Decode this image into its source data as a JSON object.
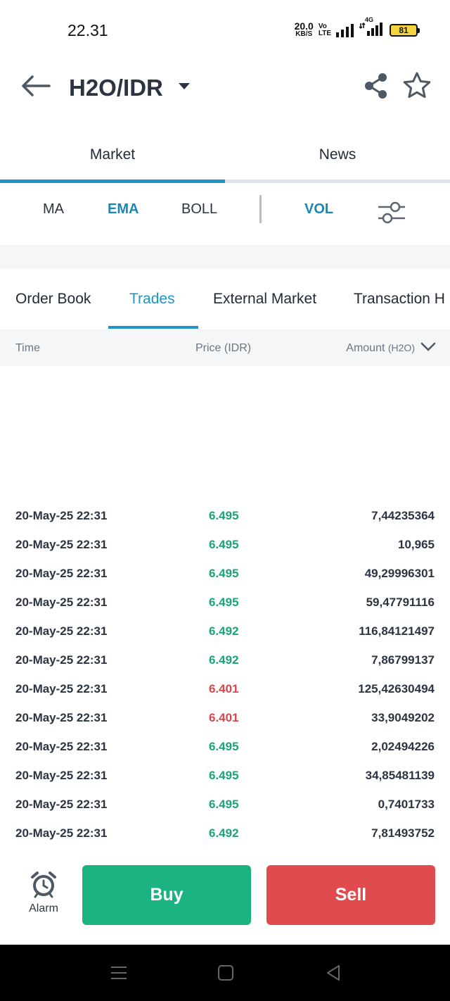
{
  "status_bar": {
    "time": "22.31",
    "net_speed_value": "20.0",
    "net_speed_unit": "KB/S",
    "volte_top": "Vo",
    "volte_bottom": "LTE",
    "network": "4G",
    "battery": "81"
  },
  "header": {
    "pair": "H2O/IDR",
    "icons": [
      "back-arrow-icon",
      "caret-down-icon",
      "share-icon",
      "star-icon"
    ]
  },
  "main_tabs": [
    {
      "label": "Market",
      "active": true
    },
    {
      "label": "News",
      "active": false
    }
  ],
  "indicators": {
    "items": [
      {
        "label": "MA",
        "active": false
      },
      {
        "label": "EMA",
        "active": true
      },
      {
        "label": "BOLL",
        "active": false
      },
      {
        "label": "VOL",
        "active": true
      }
    ],
    "settings_icon": "sliders-icon"
  },
  "sub_tabs": [
    {
      "label": "Order Book",
      "active": false
    },
    {
      "label": "Trades",
      "active": true
    },
    {
      "label": "External Market",
      "active": false
    },
    {
      "label": "Transaction H",
      "active": false
    }
  ],
  "table": {
    "headers": {
      "time": "Time",
      "price": "Price (IDR)",
      "amount": "Amount",
      "amount_unit": "(H2O)"
    },
    "rows": [
      {
        "time": "20-May-25 22:31",
        "price": "6.495",
        "side": "up",
        "amount": "7,44235364"
      },
      {
        "time": "20-May-25 22:31",
        "price": "6.495",
        "side": "up",
        "amount": "10,965"
      },
      {
        "time": "20-May-25 22:31",
        "price": "6.495",
        "side": "up",
        "amount": "49,29996301"
      },
      {
        "time": "20-May-25 22:31",
        "price": "6.495",
        "side": "up",
        "amount": "59,47791116"
      },
      {
        "time": "20-May-25 22:31",
        "price": "6.492",
        "side": "up",
        "amount": "116,84121497"
      },
      {
        "time": "20-May-25 22:31",
        "price": "6.492",
        "side": "up",
        "amount": "7,86799137"
      },
      {
        "time": "20-May-25 22:31",
        "price": "6.401",
        "side": "down",
        "amount": "125,42630494"
      },
      {
        "time": "20-May-25 22:31",
        "price": "6.401",
        "side": "down",
        "amount": "33,9049202"
      },
      {
        "time": "20-May-25 22:31",
        "price": "6.495",
        "side": "up",
        "amount": "2,02494226"
      },
      {
        "time": "20-May-25 22:31",
        "price": "6.495",
        "side": "up",
        "amount": "34,85481139"
      },
      {
        "time": "20-May-25 22:31",
        "price": "6.495",
        "side": "up",
        "amount": "0,7401733"
      },
      {
        "time": "20-May-25 22:31",
        "price": "6.492",
        "side": "up",
        "amount": "7,81493752"
      }
    ]
  },
  "actions": {
    "alarm_label": "Alarm",
    "buy_label": "Buy",
    "sell_label": "Sell"
  },
  "colors": {
    "accent": "#1f94c6",
    "up": "#1aa37a",
    "down": "#d8454a",
    "buy": "#1bb381",
    "sell": "#e04b4f"
  }
}
